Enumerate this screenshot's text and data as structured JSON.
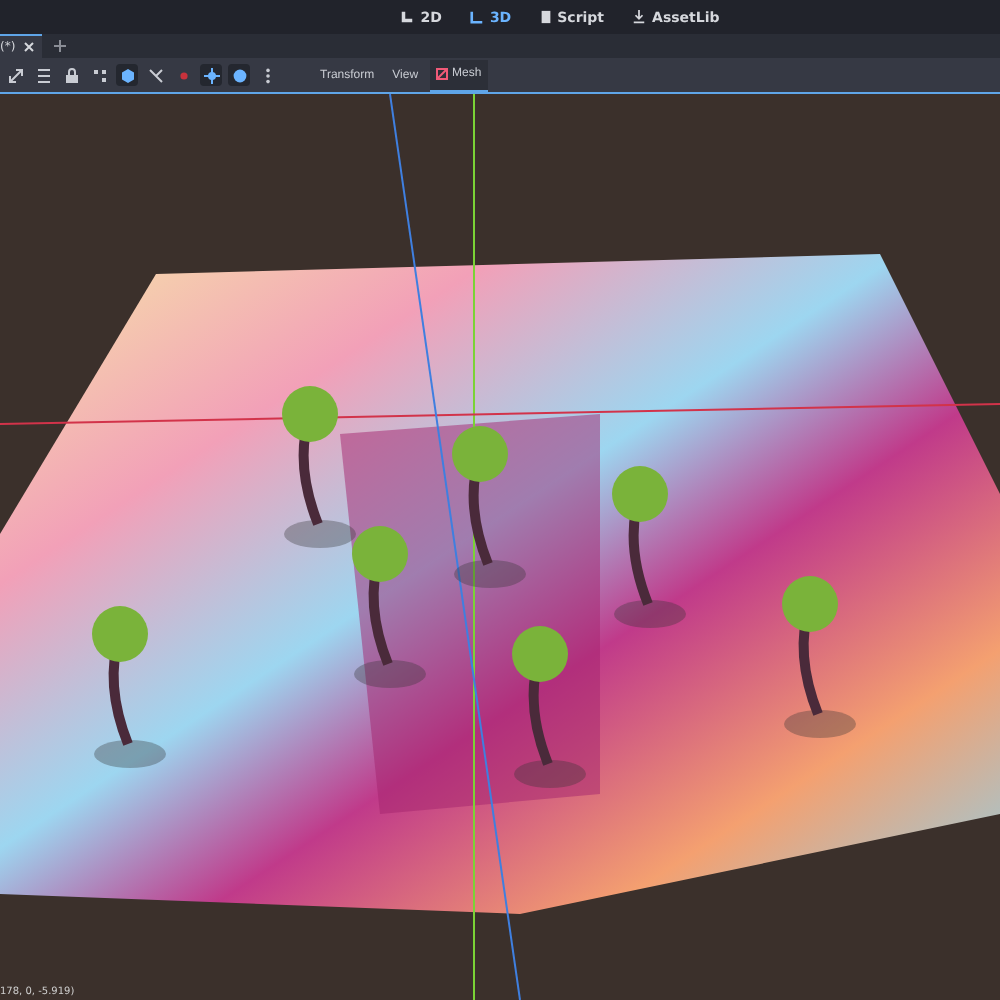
{
  "main_screens": [
    {
      "label": "2D",
      "selected": false
    },
    {
      "label": "3D",
      "selected": true
    },
    {
      "label": "Script",
      "selected": false
    },
    {
      "label": "AssetLib",
      "selected": false
    }
  ],
  "scene_tabs": [
    {
      "label": "(*)",
      "selected": true
    }
  ],
  "toolbar": {
    "tools": [
      {
        "on": false
      },
      {
        "on": false
      },
      {
        "on": false
      },
      {
        "on": false
      },
      {
        "on": true
      },
      {
        "on": false
      },
      {
        "on": false
      },
      {
        "on": true
      },
      {
        "on": true
      },
      {
        "on": false
      }
    ],
    "menus": [
      {
        "label": "Transform",
        "selected": false
      },
      {
        "label": "View",
        "selected": false
      },
      {
        "label": "Mesh",
        "selected": true
      }
    ]
  },
  "status": "178, 0, -5.919)"
}
